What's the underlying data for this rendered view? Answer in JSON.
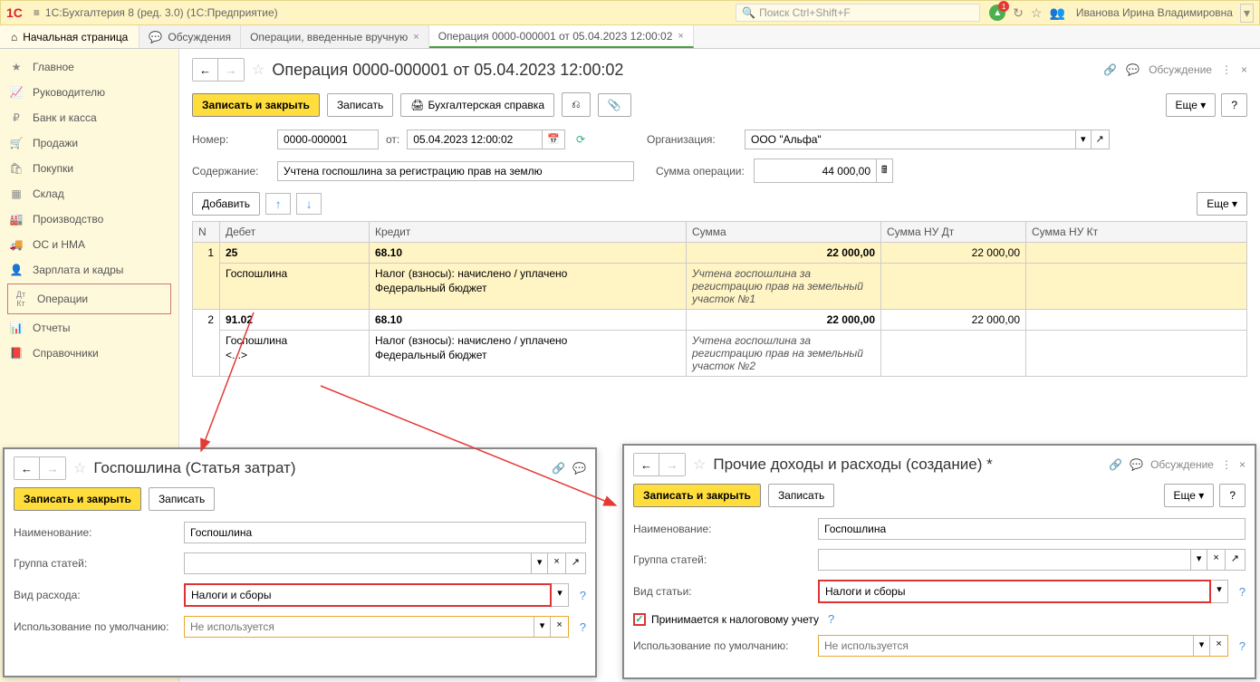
{
  "header": {
    "app_title": "1С:Бухгалтерия 8 (ред. 3.0)  (1С:Предприятие)",
    "search_placeholder": "Поиск Ctrl+Shift+F",
    "bell_count": "1",
    "user_name": "Иванова Ирина Владимировна"
  },
  "tabs": {
    "home": "Начальная страница",
    "t1": "Обсуждения",
    "t2": "Операции, введенные вручную",
    "t3": "Операция 0000-000001 от 05.04.2023 12:00:02"
  },
  "sidebar": {
    "items": [
      "Главное",
      "Руководителю",
      "Банк и касса",
      "Продажи",
      "Покупки",
      "Склад",
      "Производство",
      "ОС и НМА",
      "Зарплата и кадры",
      "Операции",
      "Отчеты",
      "Справочники"
    ]
  },
  "doc": {
    "title": "Операция 0000-000001 от 05.04.2023 12:00:02",
    "discuss": "Обсуждение",
    "btn_save_close": "Записать и закрыть",
    "btn_save": "Записать",
    "btn_print": "Бухгалтерская справка",
    "more": "Еще",
    "q": "?",
    "lbl_number": "Номер:",
    "val_number": "0000-000001",
    "lbl_from": "от:",
    "val_date": "05.04.2023 12:00:02",
    "lbl_org": "Организация:",
    "val_org": "ООО \"Альфа\"",
    "lbl_content": "Содержание:",
    "val_content": "Учтена госпошлина за регистрацию прав на землю",
    "lbl_sum": "Сумма операции:",
    "val_sum": "44 000,00",
    "btn_add": "Добавить"
  },
  "table": {
    "headers": [
      "N",
      "Дебет",
      "Кредит",
      "Сумма",
      "Сумма НУ Дт",
      "Сумма НУ Кт"
    ],
    "rows": [
      {
        "n": "1",
        "debit": "25",
        "credit": "68.10",
        "sum": "22 000,00",
        "sum_dt": "22 000,00",
        "sum_kt": "",
        "debit_sub1": "Госпошлина",
        "credit_sub1": "Налог (взносы): начислено / уплачено",
        "credit_sub2": "Федеральный бюджет",
        "desc": "Учтена госпошлина за регистрацию прав на земельный участок №1"
      },
      {
        "n": "2",
        "debit": "91.02",
        "credit": "68.10",
        "sum": "22 000,00",
        "sum_dt": "22 000,00",
        "sum_kt": "",
        "debit_sub1": "Госпошлина",
        "debit_sub2": "<...>",
        "credit_sub1": "Налог (взносы): начислено / уплачено",
        "credit_sub2": "Федеральный бюджет",
        "desc": "Учтена госпошлина за регистрацию прав на земельный участок №2"
      }
    ]
  },
  "popup_left": {
    "title": "Госпошлина (Статья затрат)",
    "btn_save_close": "Записать и закрыть",
    "btn_save": "Записать",
    "lbl_name": "Наименование:",
    "val_name": "Госпошлина",
    "lbl_group": "Группа статей:",
    "lbl_type": "Вид расхода:",
    "val_type": "Налоги и сборы",
    "lbl_default": "Использование по умолчанию:",
    "ph_default": "Не используется"
  },
  "popup_right": {
    "title": "Прочие доходы и расходы (создание) *",
    "discuss": "Обсуждение",
    "btn_save_close": "Записать и закрыть",
    "btn_save": "Записать",
    "more": "Еще",
    "q": "?",
    "lbl_name": "Наименование:",
    "val_name": "Госпошлина",
    "lbl_group": "Группа статей:",
    "lbl_type": "Вид статьи:",
    "val_type": "Налоги и сборы",
    "chk_label": "Принимается к налоговому учету",
    "lbl_default": "Использование по умолчанию:",
    "ph_default": "Не используется"
  }
}
